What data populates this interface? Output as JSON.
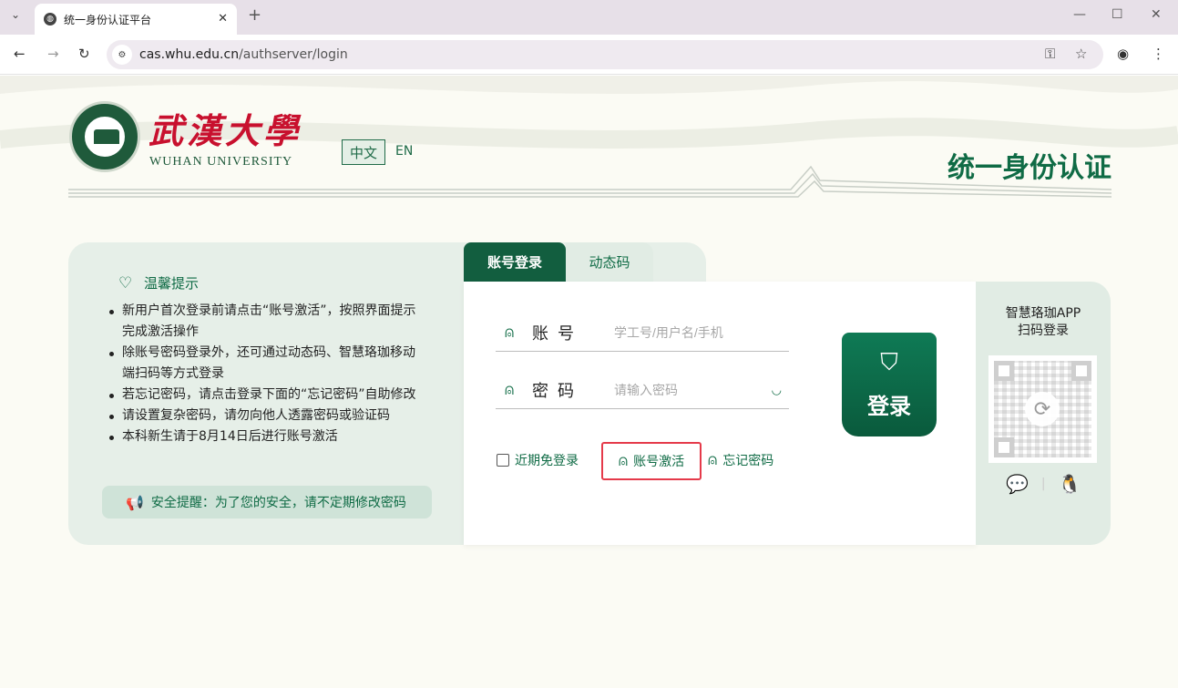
{
  "browser": {
    "tab_title": "统一身份认证平台",
    "close_glyph": "✕",
    "newtab_glyph": "+",
    "url_host": "cas.whu.edu.cn",
    "url_path": "/authserver/login",
    "icons": [
      "tab-list-icon",
      "globe-icon",
      "close-icon",
      "plus-icon",
      "minimize-icon",
      "maximize-icon",
      "window-close-icon",
      "back-icon",
      "forward-icon",
      "reload-icon",
      "site-info-icon",
      "key-icon",
      "star-icon",
      "profile-icon",
      "menu-icon"
    ]
  },
  "header": {
    "logo_cn": "武漢大學",
    "logo_en": "WUHAN UNIVERSITY",
    "lang_zh": "中文",
    "lang_en": "EN",
    "system_title": "统一身份认证"
  },
  "tips": {
    "heading": "温馨提示",
    "items": [
      "新用户首次登录前请点击“账号激活”，按照界面提示完成激活操作",
      "除账号密码登录外，还可通过动态码、智慧珞珈移动端扫码等方式登录",
      "若忘记密码，请点击登录下面的“忘记密码”自助修改",
      "请设置复杂密码，请勿向他人透露密码或验证码",
      "本科新生请于8月14日后进行账号激活"
    ],
    "safety": "安全提醒：为了您的安全，请不定期修改密码"
  },
  "login": {
    "tab_account": "账号登录",
    "tab_dynamic": "动态码",
    "username_label": "账号",
    "username_placeholder": "学工号/用户名/手机",
    "password_label": "密码",
    "password_placeholder": "请输入密码",
    "remember": "近期免登录",
    "activate": "账号激活",
    "forgot": "忘记密码",
    "submit": "登录"
  },
  "qr": {
    "title_line1": "智慧珞珈APP",
    "title_line2": "扫码登录",
    "sep": "|"
  },
  "colors": {
    "brand_green": "#0f6b45",
    "brand_red": "#c8102e",
    "highlight": "#e53a4a"
  }
}
